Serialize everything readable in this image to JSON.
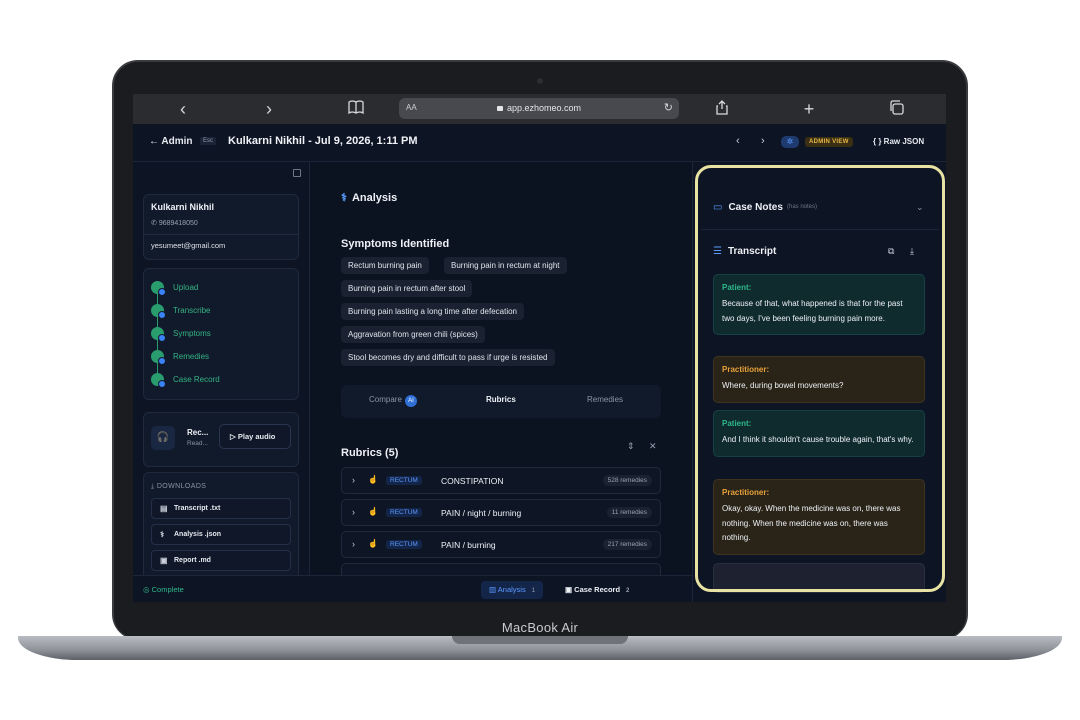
{
  "device": {
    "model_label": "MacBook Air"
  },
  "browser": {
    "text_size_label": "AA",
    "url": "app.ezhomeo.com",
    "back_icon": "‹",
    "forward_icon": "›",
    "bookmarks_icon": "book-icon",
    "share_icon": "share-icon",
    "new_tab_icon": "+",
    "tabs_icon": "tabs-icon"
  },
  "header": {
    "back_label": "Admin",
    "esc_label": "Esc",
    "title": "Kulkarni Nikhil - Jul 9, 2026, 1:11 PM",
    "prev": "‹",
    "next": "›",
    "admin_badge": "ADMIN VIEW",
    "raw_json": "Raw JSON"
  },
  "patient": {
    "name": "Kulkarni Nikhil",
    "phone": "9689418050",
    "email": "yesumeet@gmail.com"
  },
  "workflow_steps": [
    "Upload",
    "Transcribe",
    "Symptoms",
    "Remedies",
    "Case Record"
  ],
  "audio": {
    "title": "Rec...",
    "subtitle": "Read...",
    "play_label": "Play audio"
  },
  "downloads": {
    "heading": "DOWNLOADS",
    "items": [
      "Transcript .txt",
      "Analysis .json",
      "Report .md"
    ]
  },
  "analysis": {
    "heading": "Analysis",
    "symptoms_heading": "Symptoms Identified",
    "symptoms": [
      "Rectum burning pain",
      "Burning pain in rectum at night",
      "Burning pain in rectum after stool",
      "Burning pain lasting a long time after defecation",
      "Aggravation from green chili (spices)",
      "Stool becomes dry and difficult to pass if urge is resisted"
    ],
    "tabs": {
      "compare": "Compare",
      "compare_badge": "AI",
      "rubrics": "Rubrics",
      "remedies": "Remedies"
    },
    "rubrics_heading": "Rubrics (5)",
    "rubrics": [
      {
        "tag": "RECTUM",
        "name": "CONSTIPATION",
        "count": "528 remedies"
      },
      {
        "tag": "RECTUM",
        "name": "PAIN / night / burning",
        "count": "11 remedies"
      },
      {
        "tag": "RECTUM",
        "name": "PAIN / burning",
        "count": "217 remedies"
      }
    ]
  },
  "case_notes": {
    "heading": "Case Notes",
    "sub": "(has notes)"
  },
  "transcript": {
    "heading": "Transcript",
    "messages": [
      {
        "speaker": "Patient:",
        "type": "pat",
        "text": "Because of that, what happened is that for the past two days, I've been feeling burning pain more."
      },
      {
        "speaker": "Practitioner:",
        "type": "pra",
        "text": "Where, during bowel movements?"
      },
      {
        "speaker": "Patient:",
        "type": "pat",
        "text": "And I think it shouldn't cause trouble again, that's why."
      },
      {
        "speaker": "Practitioner:",
        "type": "pra",
        "text": "Okay, okay. When the medicine was on, there was nothing. When the medicine was on, there was nothing."
      }
    ]
  },
  "footer": {
    "status": "Complete",
    "analysis_tab": "Analysis",
    "analysis_count": "1",
    "case_record_tab": "Case Record",
    "case_record_count": "2"
  },
  "colors": {
    "accent": "#5b9bff",
    "success": "#2fb88a",
    "warning": "#e8a23a",
    "highlight": "#e9e3a3"
  }
}
